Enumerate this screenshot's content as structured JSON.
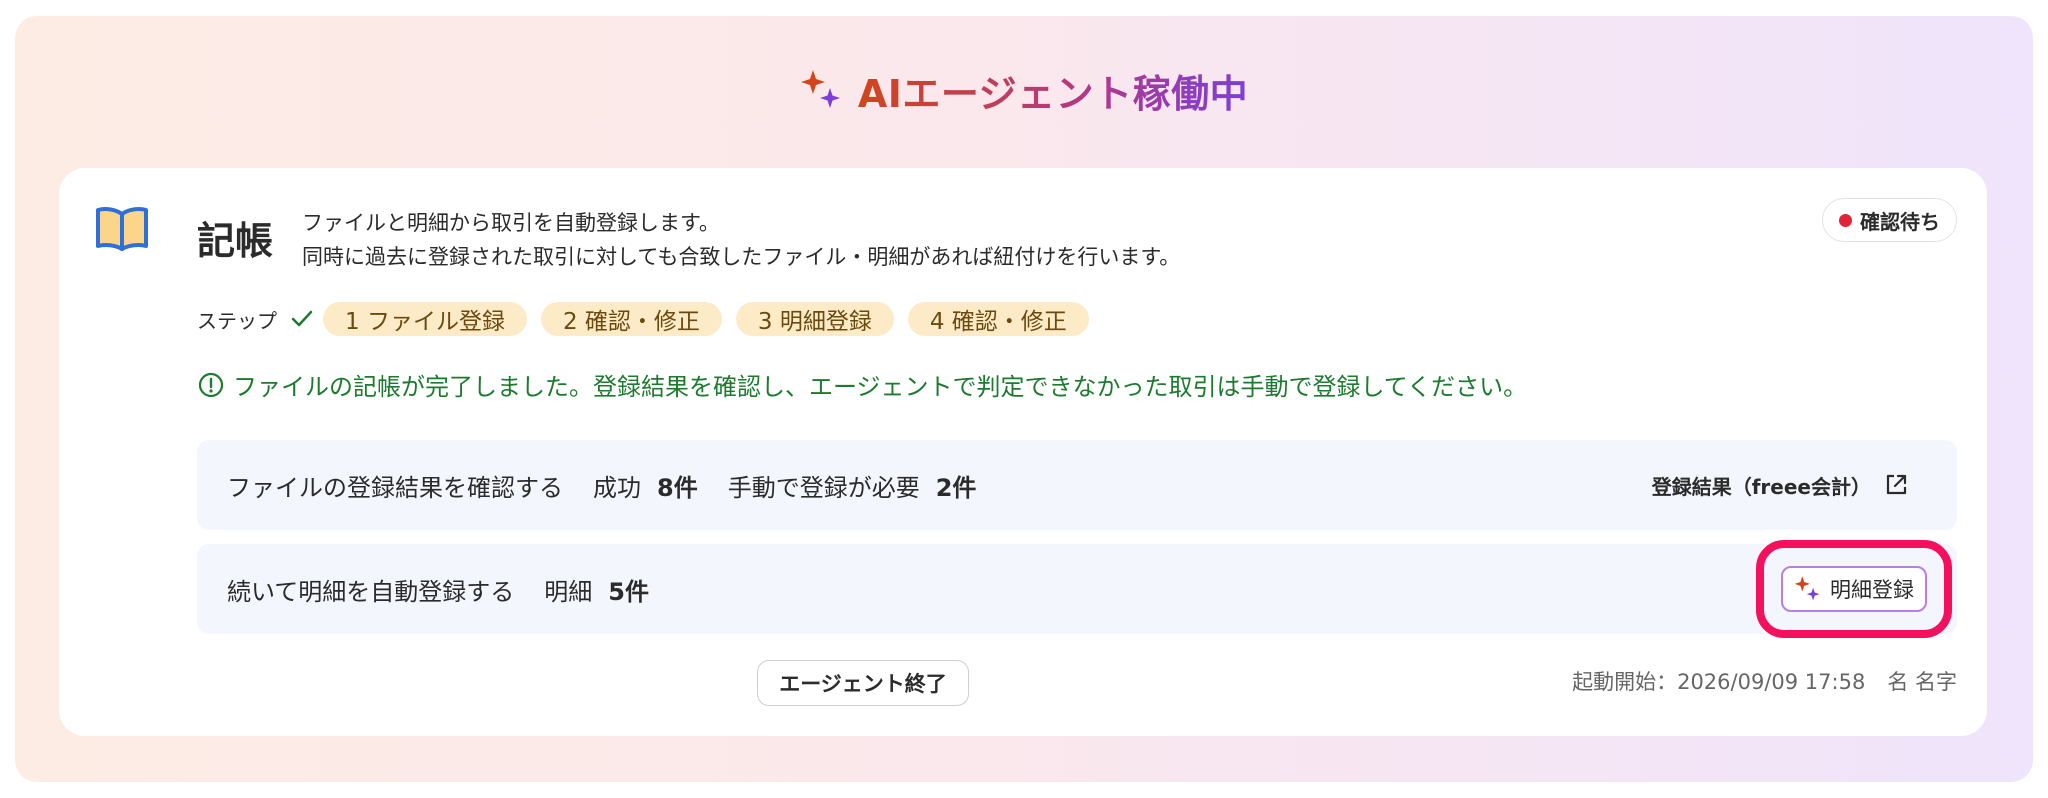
{
  "header": {
    "title": "AIエージェント稼働中"
  },
  "card": {
    "title": "記帳",
    "description": [
      "ファイルと明細から取引を自動登録します。",
      "同時に過去に登録された取引に対しても合致したファイル・明細があれば紐付けを行います。"
    ],
    "status": {
      "label": "確認待ち",
      "color": "#e0253a"
    },
    "steps": {
      "label": "ステップ",
      "items": [
        "1 ファイル登録",
        "2 確認・修正",
        "3 明細登録",
        "4 確認・修正"
      ]
    },
    "notice": "ファイルの記帳が完了しました。登録結果を確認し、エージェントで判定できなかった取引は手動で登録してください。",
    "row1": {
      "label": "ファイルの登録結果を確認する",
      "success_label": "成功",
      "success_count": "8件",
      "manual_label": "手動で登録が必要",
      "manual_count": "2件",
      "link_label": "登録結果（freee会計）"
    },
    "row2": {
      "label": "続いて明細を自動登録する",
      "detail_label": "明細",
      "detail_count": "5件",
      "button_label": "明細登録"
    },
    "end_button": "エージェント終了",
    "started_at": "起動開始：2026/09/09 17:58",
    "user_name": "名 名字"
  },
  "colors": {
    "accent_orange": "#d2451b",
    "accent_purple": "#7b3fd8",
    "success_green": "#1d7a2e",
    "step_pill_bg": "#fdebc8",
    "highlight": "#f5105d"
  }
}
